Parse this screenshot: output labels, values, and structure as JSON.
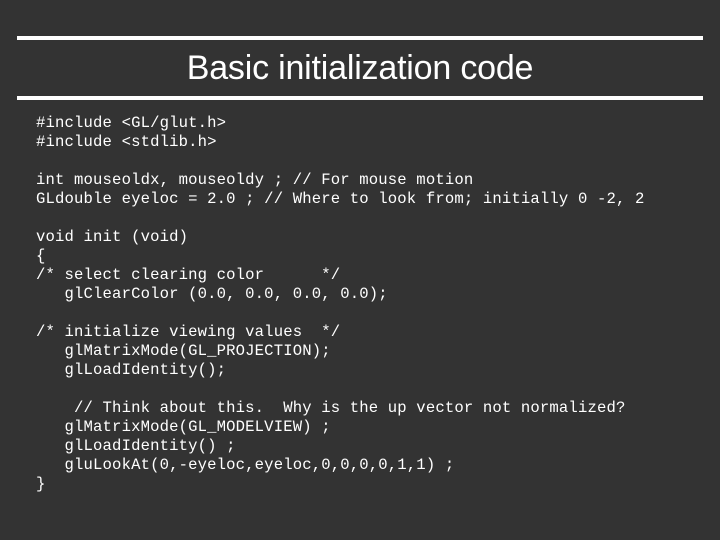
{
  "slide": {
    "title": "Basic initialization code",
    "background_color": "#333333",
    "text_color": "#ffffff",
    "rule_color": "#ffffff"
  },
  "code": {
    "language": "c",
    "lines": [
      "#include <GL/glut.h>",
      "#include <stdlib.h>",
      "",
      "int mouseoldx, mouseoldy ; // For mouse motion",
      "GLdouble eyeloc = 2.0 ; // Where to look from; initially 0 -2, 2",
      "",
      "void init (void)",
      "{",
      "/* select clearing color      */",
      "   glClearColor (0.0, 0.0, 0.0, 0.0);",
      "",
      "/* initialize viewing values  */",
      "   glMatrixMode(GL_PROJECTION);",
      "   glLoadIdentity();",
      "",
      "    // Think about this.  Why is the up vector not normalized?",
      "   glMatrixMode(GL_MODELVIEW) ;",
      "   glLoadIdentity() ;",
      "   gluLookAt(0,-eyeloc,eyeloc,0,0,0,0,1,1) ;",
      "}"
    ]
  }
}
